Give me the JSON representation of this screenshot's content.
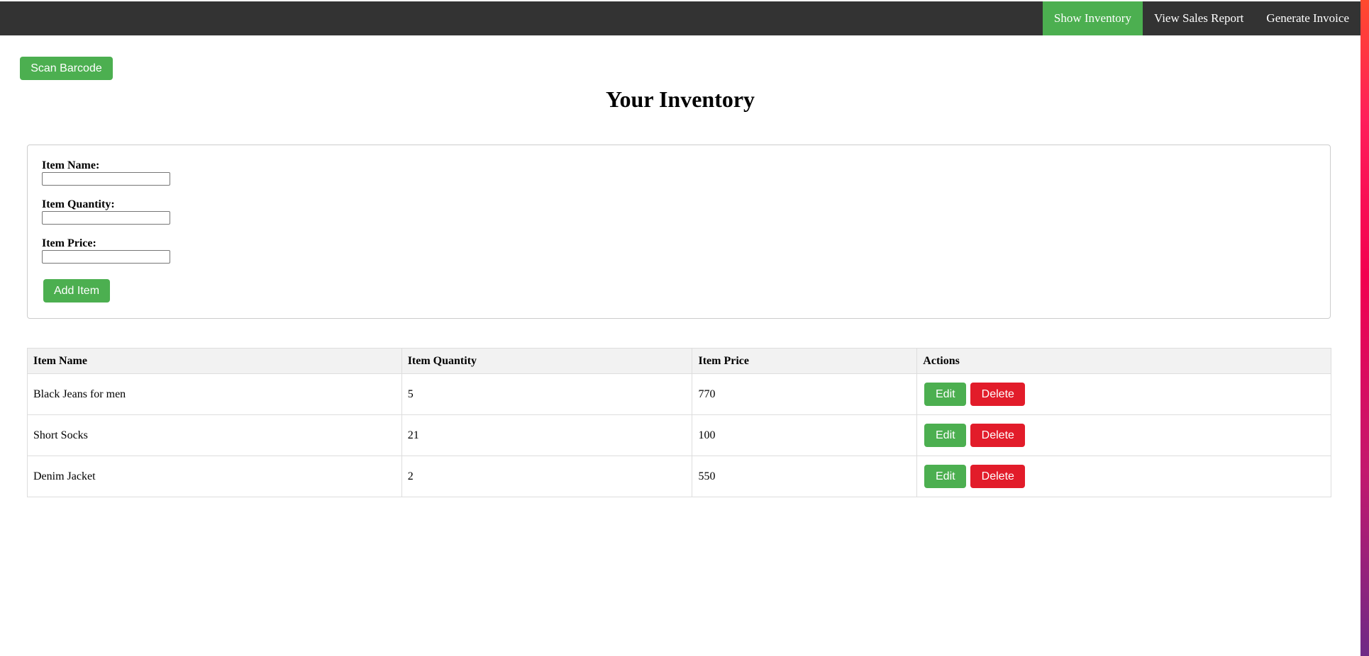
{
  "nav": {
    "links": [
      {
        "label": "Show Inventory",
        "active": true
      },
      {
        "label": "View Sales Report",
        "active": false
      },
      {
        "label": "Generate Invoice",
        "active": false
      }
    ]
  },
  "scan_button": "Scan Barcode",
  "page_title": "Your Inventory",
  "form": {
    "item_name_label": "Item Name:",
    "item_name_value": "",
    "item_quantity_label": "Item Quantity:",
    "item_quantity_value": "",
    "item_price_label": "Item Price:",
    "item_price_value": "",
    "add_button": "Add Item"
  },
  "table": {
    "headers": [
      "Item Name",
      "Item Quantity",
      "Item Price",
      "Actions"
    ],
    "rows": [
      {
        "name": "Black Jeans for men",
        "quantity": "5",
        "price": "770"
      },
      {
        "name": "Short Socks",
        "quantity": "21",
        "price": "100"
      },
      {
        "name": "Denim Jacket",
        "quantity": "2",
        "price": "550"
      }
    ],
    "edit_label": "Edit",
    "delete_label": "Delete"
  },
  "colors": {
    "navbar": "#333333",
    "accent_green": "#4caf50",
    "danger_red": "#e21c2a"
  }
}
